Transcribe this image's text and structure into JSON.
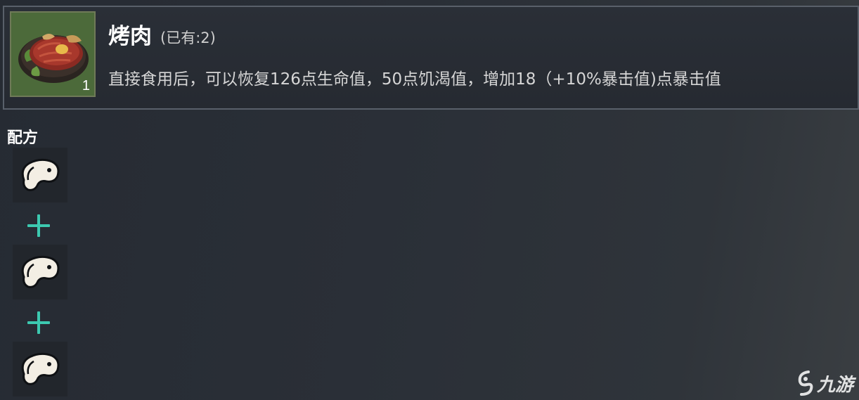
{
  "item": {
    "name": "烤肉",
    "owned": "(已有:2)",
    "count": "1",
    "description": "直接食用后，可以恢复126点生命值，50点饥渴值，增加18（+10%暴击值)点暴击值",
    "icon": "roast-meat-icon"
  },
  "recipe": {
    "title": "配方",
    "ingredients": [
      {
        "icon": "raw-meat-icon"
      },
      {
        "icon": "raw-meat-icon"
      },
      {
        "icon": "raw-meat-icon"
      }
    ],
    "separator_icon": "plus-icon"
  },
  "watermark": {
    "text": "九游",
    "icon": "jiuyou-logo-icon"
  },
  "colors": {
    "accent": "#3cc9b0",
    "panel_border": "#59606a",
    "item_bg": "#4c6a3a"
  }
}
